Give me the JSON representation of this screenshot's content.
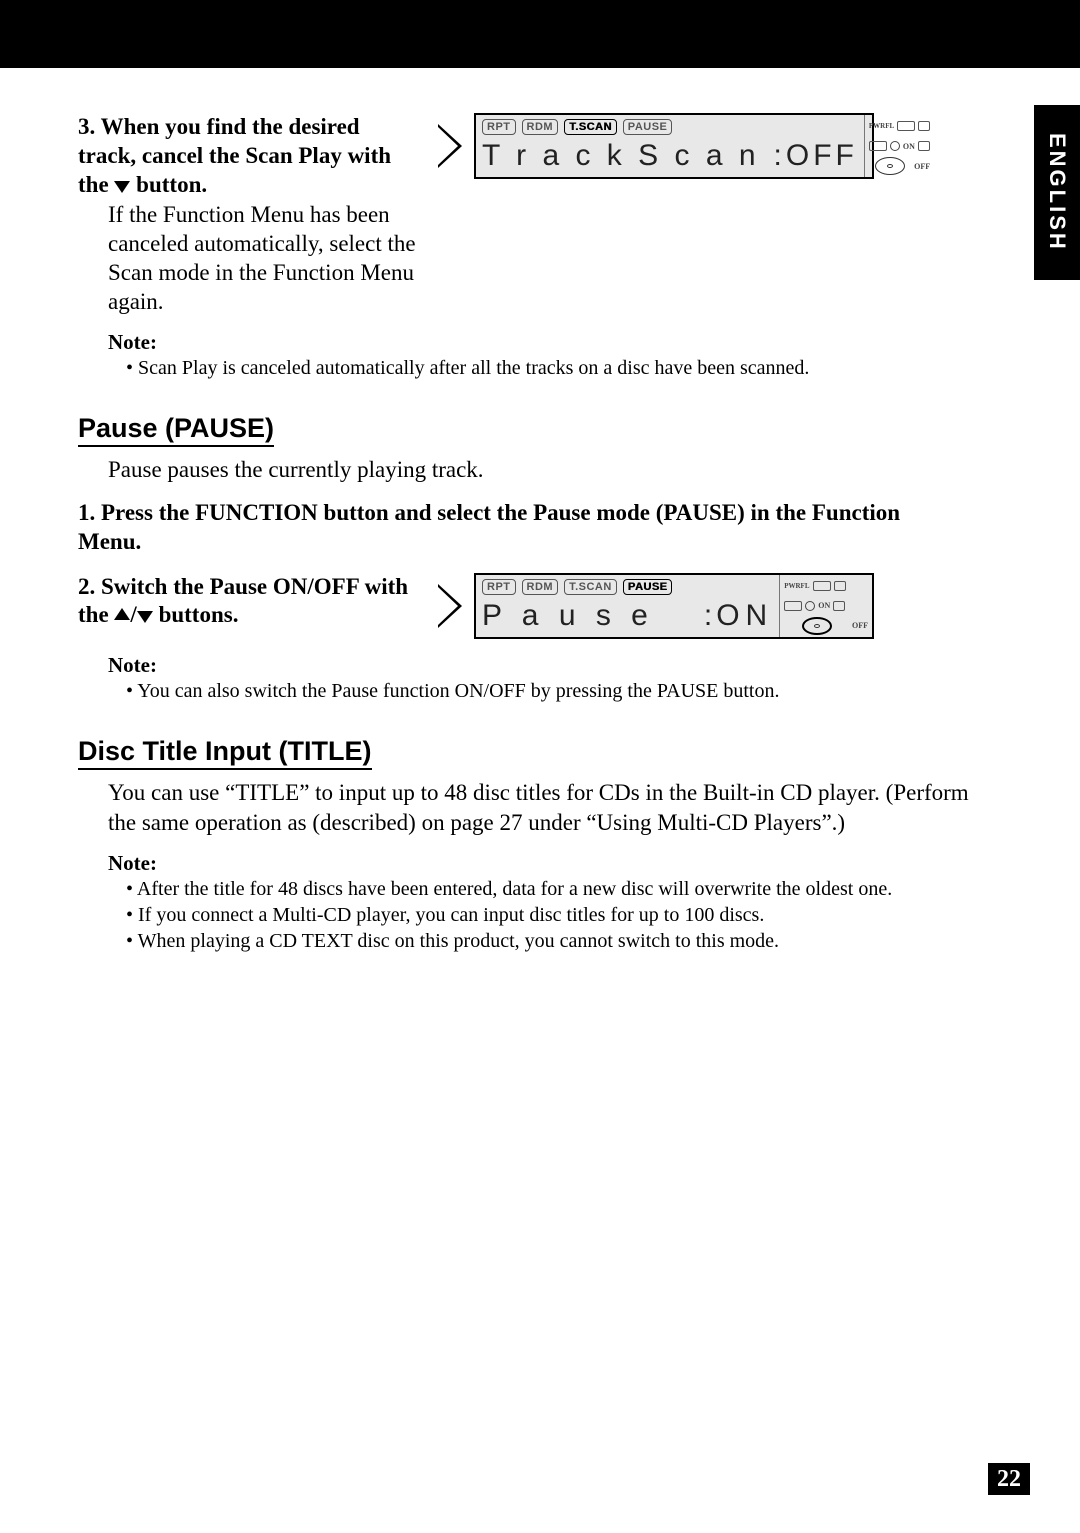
{
  "lang_tab": "ENGLISH",
  "step3": {
    "num": "3.",
    "text_before": "When you find the desired track, cancel the Scan Play with the ",
    "text_after": " button.",
    "body": "If the Function Menu has been canceled automatically, select the Scan mode in the Function Menu again."
  },
  "display1": {
    "badges": {
      "rpt": "RPT",
      "rdm": "RDM",
      "tscan": "T.SCAN",
      "pause": "PAUSE"
    },
    "line_label": "T r a c k  S c a n",
    "line_sep": ":",
    "line_value": "OFF",
    "side": {
      "pwrfl": "PWRFL",
      "on": "ON",
      "off": "OFF"
    }
  },
  "note1": {
    "heading": "Note:",
    "items": [
      "Scan Play is canceled automatically after all the tracks on a disc have been scanned."
    ]
  },
  "pause": {
    "heading": "Pause (PAUSE)",
    "intro": "Pause pauses the currently playing track.",
    "step1": {
      "num": "1.",
      "text": "Press the FUNCTION button and select the Pause mode (PAUSE) in the Function Menu."
    },
    "step2": {
      "num": "2.",
      "text_before": "Switch the Pause ON/OFF with the ",
      "text_mid": "/",
      "text_after": " buttons."
    }
  },
  "display2": {
    "badges": {
      "rpt": "RPT",
      "rdm": "RDM",
      "tscan": "T.SCAN",
      "pause": "PAUSE"
    },
    "line_label": "P a u s e",
    "line_sep": ":",
    "line_value": "ON",
    "side": {
      "pwrfl": "PWRFL",
      "on": "ON",
      "off": "OFF"
    }
  },
  "note2": {
    "heading": "Note:",
    "items": [
      "You can also switch the Pause function ON/OFF by pressing the PAUSE button."
    ]
  },
  "title_sec": {
    "heading": "Disc Title Input (TITLE)",
    "body": "You can use “TITLE” to input up to 48 disc titles for CDs in the Built-in CD player. (Perform the same operation as (described) on page 27 under “Using Multi-CD Players”.)"
  },
  "note3": {
    "heading": "Note:",
    "items": [
      "After the title for 48 discs have been entered, data for a new disc will overwrite the oldest one.",
      "If you connect a Multi-CD player, you can input disc titles for up to 100 discs.",
      "When playing a CD TEXT disc on this product, you cannot switch to this mode."
    ]
  },
  "page_number": "22"
}
